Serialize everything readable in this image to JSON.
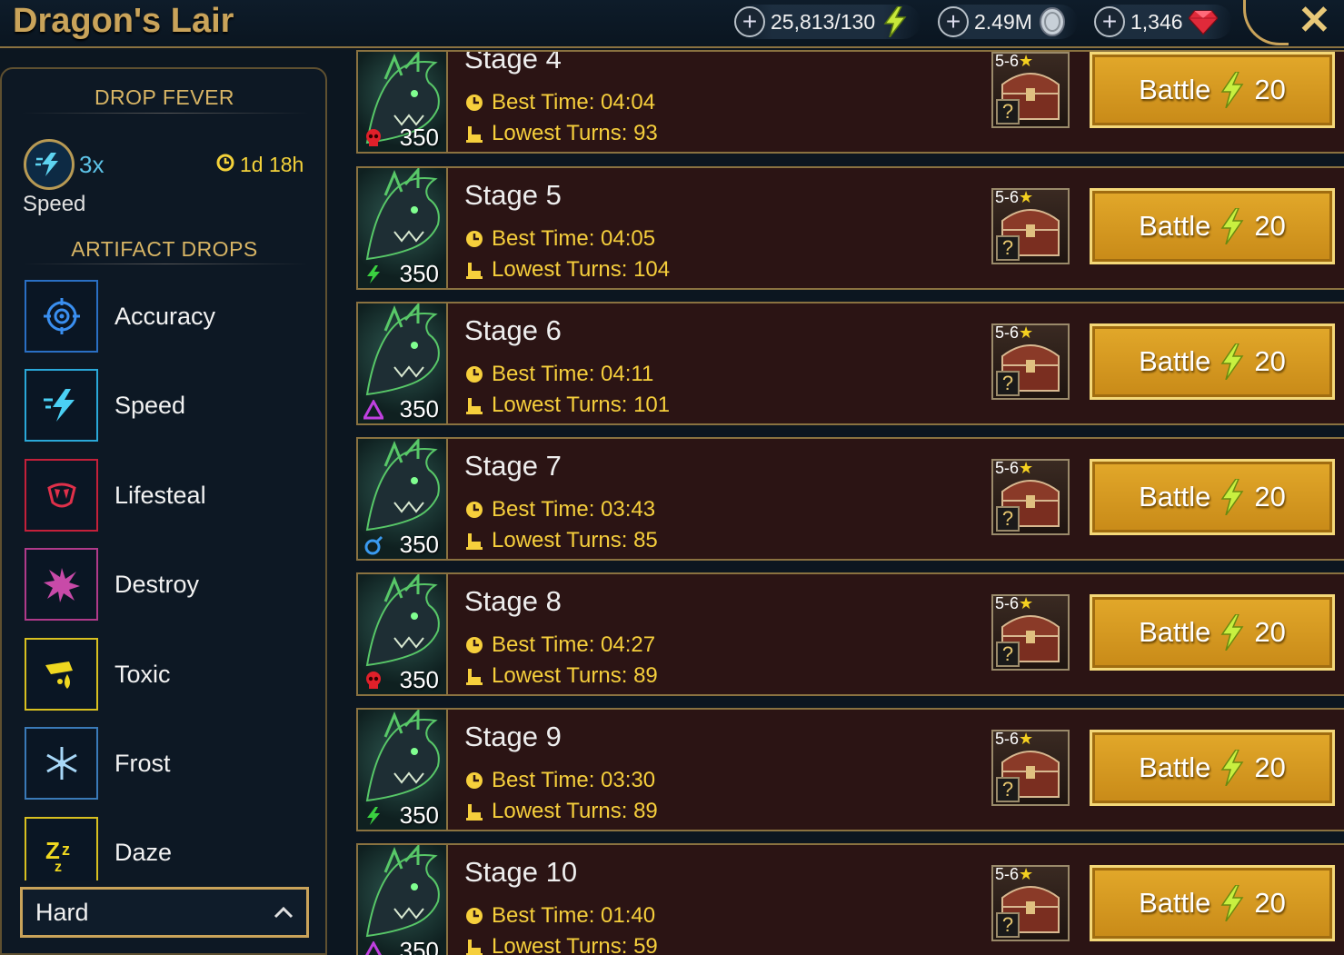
{
  "header": {
    "title": "Dragon's Lair",
    "energy": "25,813/130",
    "silver": "2.49M",
    "gems": "1,346"
  },
  "sidebar": {
    "drop_fever_title": "DROP FEVER",
    "fever_multiplier": "3x",
    "fever_timer": "1d 18h",
    "fever_stat": "Speed",
    "artifact_drops_title": "ARTIFACT DROPS",
    "artifacts": [
      {
        "label": "Accuracy",
        "icon": "target-icon",
        "color": "#2a6fc4"
      },
      {
        "label": "Speed",
        "icon": "speed-icon",
        "color": "#2aa8d8"
      },
      {
        "label": "Lifesteal",
        "icon": "fangs-icon",
        "color": "#c4203a"
      },
      {
        "label": "Destroy",
        "icon": "burst-icon",
        "color": "#b03a8a"
      },
      {
        "label": "Toxic",
        "icon": "toxic-drop-icon",
        "color": "#d8c020"
      },
      {
        "label": "Frost",
        "icon": "snowflake-icon",
        "color": "#3a7ab8"
      },
      {
        "label": "Daze",
        "icon": "zzz-icon",
        "color": "#d8c020"
      }
    ],
    "difficulty": "Hard"
  },
  "stages": [
    {
      "name": "Stage 4",
      "best_time": "Best Time: 04:04",
      "lowest_turns": "Lowest Turns: 93",
      "level": "350",
      "affinity": "skull",
      "stars": "5-6",
      "battle_label": "Battle",
      "cost": "20"
    },
    {
      "name": "Stage 5",
      "best_time": "Best Time: 04:05",
      "lowest_turns": "Lowest Turns: 104",
      "level": "350",
      "affinity": "force",
      "stars": "5-6",
      "battle_label": "Battle",
      "cost": "20"
    },
    {
      "name": "Stage 6",
      "best_time": "Best Time: 04:11",
      "lowest_turns": "Lowest Turns: 101",
      "level": "350",
      "affinity": "void",
      "stars": "5-6",
      "battle_label": "Battle",
      "cost": "20"
    },
    {
      "name": "Stage 7",
      "best_time": "Best Time: 03:43",
      "lowest_turns": "Lowest Turns: 85",
      "level": "350",
      "affinity": "magic",
      "stars": "5-6",
      "battle_label": "Battle",
      "cost": "20"
    },
    {
      "name": "Stage 8",
      "best_time": "Best Time: 04:27",
      "lowest_turns": "Lowest Turns: 89",
      "level": "350",
      "affinity": "skull",
      "stars": "5-6",
      "battle_label": "Battle",
      "cost": "20"
    },
    {
      "name": "Stage 9",
      "best_time": "Best Time: 03:30",
      "lowest_turns": "Lowest Turns: 89",
      "level": "350",
      "affinity": "force",
      "stars": "5-6",
      "battle_label": "Battle",
      "cost": "20"
    },
    {
      "name": "Stage 10",
      "best_time": "Best Time: 01:40",
      "lowest_turns": "Lowest Turns: 59",
      "level": "350",
      "affinity": "void",
      "stars": "5-6",
      "battle_label": "Battle",
      "cost": "20"
    }
  ]
}
